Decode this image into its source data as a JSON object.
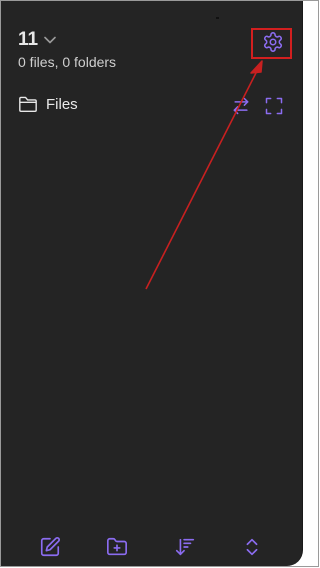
{
  "header": {
    "vault_name": "11",
    "stats": "0 files, 0 folders",
    "settings_icon": "gear-icon",
    "dropdown_icon": "chevron-down-icon"
  },
  "files_section": {
    "label": "Files",
    "folder_icon": "folder-icon",
    "swap_icon": "swap-icon",
    "expand_icon": "expand-icon"
  },
  "bottom_bar": {
    "items": [
      {
        "icon": "new-note-icon"
      },
      {
        "icon": "new-folder-icon"
      },
      {
        "icon": "sort-icon"
      },
      {
        "icon": "collapse-expand-icon"
      }
    ]
  },
  "colors": {
    "panel_background": "#242424",
    "accent": "#8b6cf0",
    "annotation": "#d21f1f",
    "text": "#e8e8e8"
  }
}
